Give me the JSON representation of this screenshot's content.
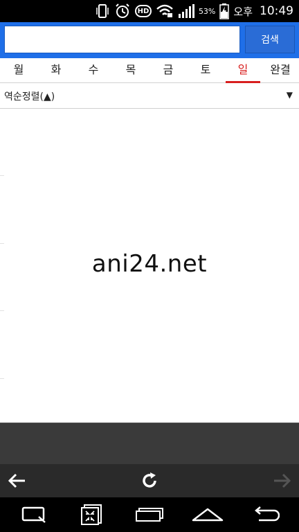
{
  "status_bar": {
    "battery_percent": "53%",
    "time_period": "오후",
    "time": "10:49",
    "hd_badge": "HD",
    "icons": [
      "phone-vibrate-icon",
      "alarm-icon",
      "hd-call-icon",
      "wifi-icon",
      "signal-icon",
      "battery-charging-icon"
    ]
  },
  "search": {
    "value": "",
    "button_label": "검색"
  },
  "tabs": [
    {
      "label": "월",
      "active": false
    },
    {
      "label": "화",
      "active": false
    },
    {
      "label": "수",
      "active": false
    },
    {
      "label": "목",
      "active": false
    },
    {
      "label": "금",
      "active": false
    },
    {
      "label": "토",
      "active": false
    },
    {
      "label": "일",
      "active": true
    },
    {
      "label": "완결",
      "active": false
    }
  ],
  "sort": {
    "label": "역순정렬(▲)",
    "caret": "▼"
  },
  "content": {
    "watermark": "ani24.net"
  },
  "browser_nav": {
    "icons": [
      "back-arrow-icon",
      "refresh-icon",
      "forward-arrow-icon"
    ]
  },
  "system_nav": {
    "icons": [
      "qslide-icon",
      "capture-icon",
      "recent-apps-icon",
      "home-icon",
      "back-icon"
    ]
  },
  "colors": {
    "header_blue": "#1f6fe8",
    "active_tab_red": "#d81f1f"
  }
}
